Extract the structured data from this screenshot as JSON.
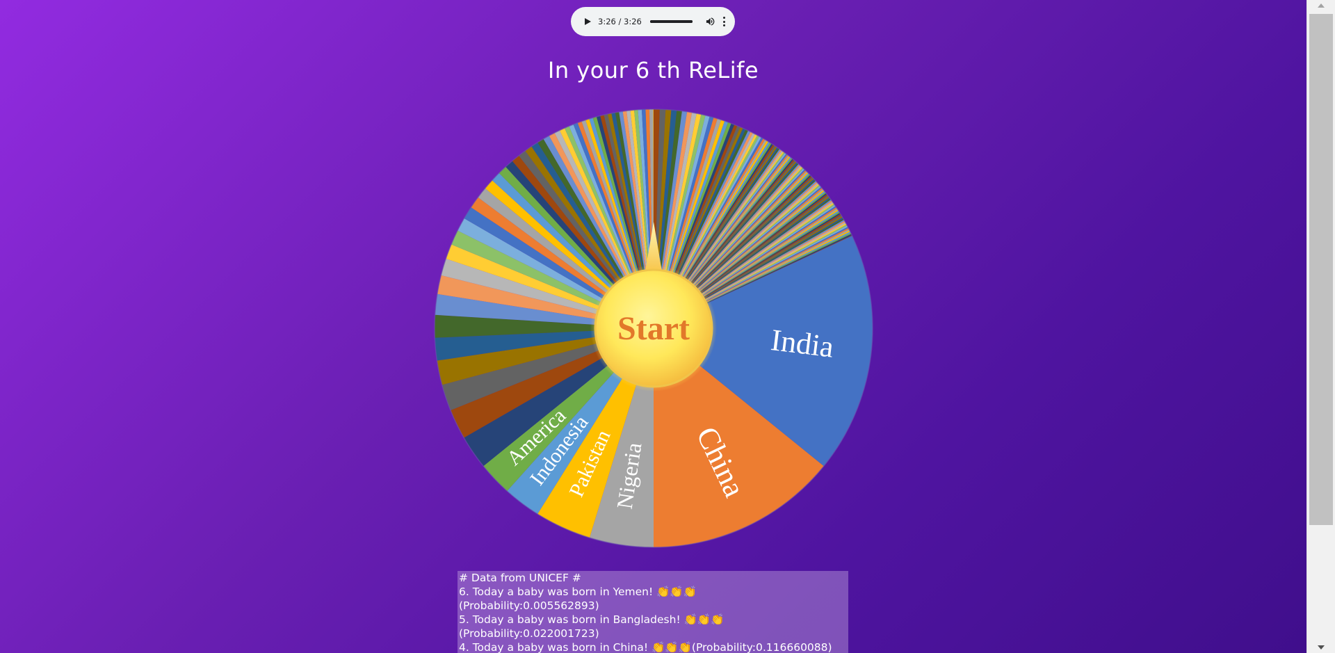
{
  "audio": {
    "time": "3:26 / 3:26",
    "progress_fraction": 1.0
  },
  "page": {
    "title": "In your 6 th ReLife"
  },
  "wheel": {
    "start_label": "Start",
    "labeled_segments": [
      {
        "label": "India",
        "color": "#4472c4"
      },
      {
        "label": "China",
        "color": "#ed7d31"
      },
      {
        "label": "Nigeria",
        "color": "#a5a5a5"
      },
      {
        "label": "Pakistan",
        "color": "#ffc000"
      },
      {
        "label": "Indonesia",
        "color": "#5b9bd5"
      },
      {
        "label": "America",
        "color": "#70ad47"
      }
    ]
  },
  "log": {
    "lines": [
      "# Data from UNICEF #",
      "6. Today a baby was born in Yemen! 👏👏👏",
      "(Probability:0.005562893)",
      "5. Today a baby was born in Bangladesh! 👏👏👏",
      "(Probability:0.022001723)",
      "4. Today a baby was born in China! 👏👏👏(Probability:0.116660088)"
    ]
  }
}
